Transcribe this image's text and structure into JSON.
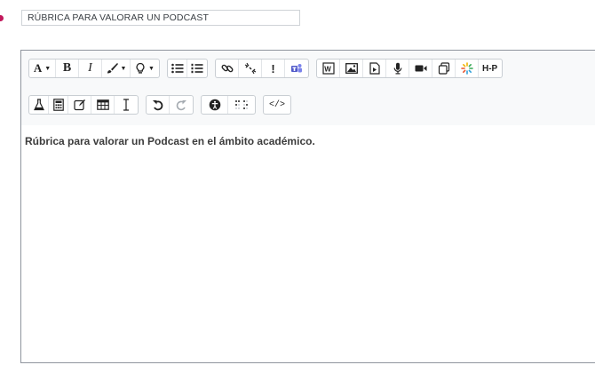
{
  "form": {
    "name_field": {
      "value": "RÚBRICA PARA VALORAR UN PODCAST"
    }
  },
  "toolbar": {
    "font_label": "A",
    "bold_label": "B",
    "italic_label": "I",
    "exclamation_label": "!",
    "h5p_label": "H-P",
    "code_label": "</>"
  },
  "editor": {
    "content": "Rúbrica para valorar un Podcast en el ámbito académico."
  },
  "colors": {
    "required": "#c2185b",
    "teams": "#5059c9",
    "editor_border": "#8f959e",
    "toolbar_bg": "#f8f9fa"
  }
}
